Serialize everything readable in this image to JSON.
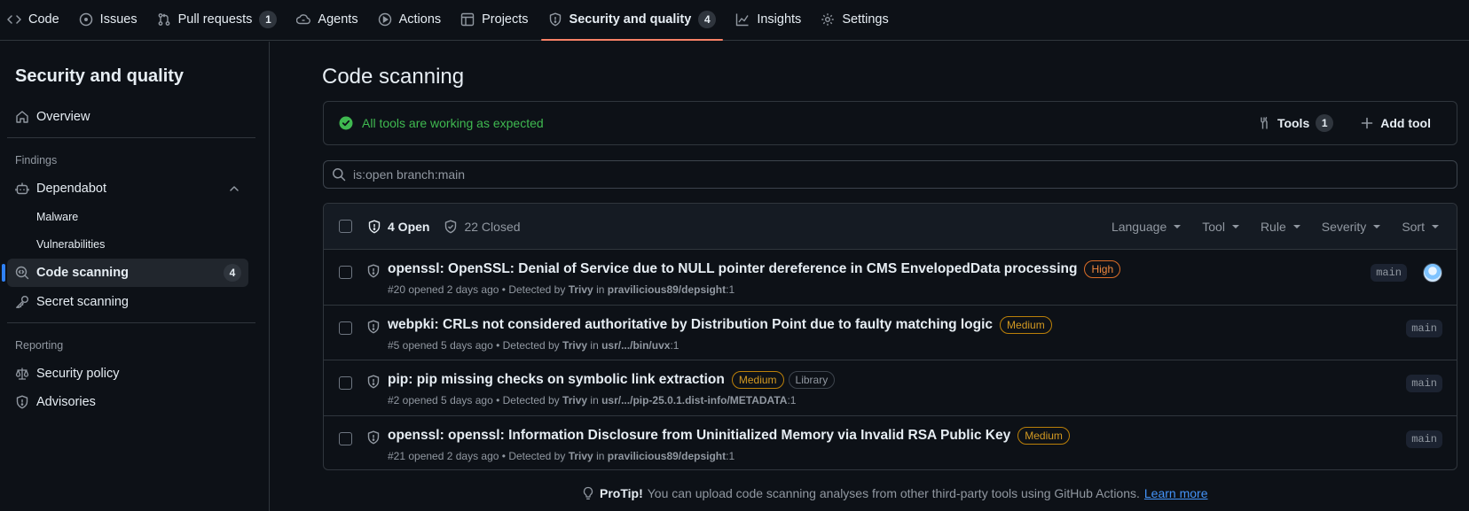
{
  "nav": {
    "tabs": [
      {
        "label": "Code",
        "icon": "code-icon"
      },
      {
        "label": "Issues",
        "icon": "issue-opened-icon"
      },
      {
        "label": "Pull requests",
        "icon": "git-pull-request-icon",
        "count": "1"
      },
      {
        "label": "Agents",
        "icon": "agent-icon"
      },
      {
        "label": "Actions",
        "icon": "play-icon"
      },
      {
        "label": "Projects",
        "icon": "table-icon"
      },
      {
        "label": "Security and quality",
        "icon": "shield-icon",
        "count": "4",
        "selected": true
      },
      {
        "label": "Insights",
        "icon": "graph-icon"
      },
      {
        "label": "Settings",
        "icon": "gear-icon"
      }
    ]
  },
  "sidebar": {
    "title": "Security and quality",
    "overview": "Overview",
    "findings_heading": "Findings",
    "dependabot": "Dependabot",
    "malware": "Malware",
    "vulnerabilities": "Vulnerabilities",
    "code_scanning": "Code scanning",
    "code_scanning_count": "4",
    "secret_scanning": "Secret scanning",
    "reporting_heading": "Reporting",
    "security_policy": "Security policy",
    "advisories": "Advisories"
  },
  "main": {
    "title": "Code scanning",
    "status": "All tools are working as expected",
    "tools_label": "Tools",
    "tools_count": "1",
    "add_tool_label": "Add tool",
    "search_value": "is:open branch:main",
    "open_label": "4 Open",
    "closed_label": "22 Closed",
    "filters": [
      "Language",
      "Tool",
      "Rule",
      "Severity",
      "Sort"
    ],
    "alerts": [
      {
        "title": "openssl: OpenSSL: Denial of Service due to NULL pointer dereference in CMS EnvelopedData processing",
        "severity": "High",
        "extra_label": "",
        "meta_prefix": "#20 opened 2 days ago • Detected by",
        "tool": "Trivy",
        "meta_in": "in",
        "location": "pravilicious89/depsight",
        "line": ":1",
        "branch": "main",
        "has_avatar": true
      },
      {
        "title": "webpki: CRLs not considered authoritative by Distribution Point due to faulty matching logic",
        "severity": "Medium",
        "extra_label": "",
        "meta_prefix": "#5 opened 5 days ago • Detected by",
        "tool": "Trivy",
        "meta_in": "in",
        "location": "usr/.../bin/uvx",
        "line": ":1",
        "branch": "main",
        "has_avatar": false
      },
      {
        "title": "pip: pip missing checks on symbolic link extraction",
        "severity": "Medium",
        "extra_label": "Library",
        "meta_prefix": "#2 opened 5 days ago • Detected by",
        "tool": "Trivy",
        "meta_in": "in",
        "location": "usr/.../pip-25.0.1.dist-info/METADATA",
        "line": ":1",
        "branch": "main",
        "has_avatar": false
      },
      {
        "title": "openssl: openssl: Information Disclosure from Uninitialized Memory via Invalid RSA Public Key",
        "severity": "Medium",
        "extra_label": "",
        "meta_prefix": "#21 opened 2 days ago • Detected by",
        "tool": "Trivy",
        "meta_in": "in",
        "location": "pravilicious89/depsight",
        "line": ":1",
        "branch": "main",
        "has_avatar": false
      }
    ],
    "protip_bold": "ProTip!",
    "protip_text": "You can upload code scanning analyses from other third-party tools using GitHub Actions.",
    "protip_link": "Learn more"
  },
  "colors": {
    "accent_underline": "#f78166",
    "success": "#3fb950",
    "high": "#db6d28",
    "medium": "#bb8009",
    "link": "#4493f8"
  }
}
